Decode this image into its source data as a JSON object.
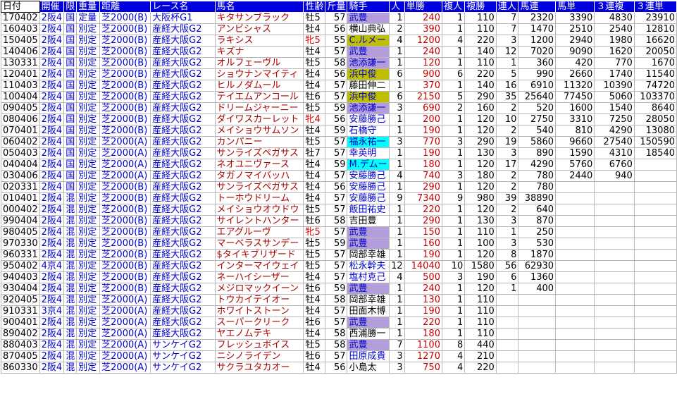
{
  "columns": [
    "日付",
    "開催",
    "限",
    "重量",
    "距離",
    "レース名",
    "馬名",
    "性齢",
    "斤量",
    "騎手",
    "人",
    "単勝",
    "複人",
    "複勝",
    "連人",
    "馬連",
    "馬単",
    "３連複",
    "３連単"
  ],
  "rows": [
    {
      "date": "170402",
      "kai": "2阪4",
      "gen": "国",
      "jyu": "定量",
      "kyori": "芝2000(B)",
      "race": "大阪杯G1",
      "horse": "キタサンブラック",
      "sei": "牡5",
      "kin": "57",
      "jockey": "武豊",
      "jk": "purple",
      "ninki": "1",
      "tansho": "240",
      "fukuninki": "1",
      "fukusho": "110",
      "renjin": "7",
      "umaren": "2320",
      "umatan": "3390",
      "sanfuku": "4830",
      "santan": "23910"
    },
    {
      "date": "160403",
      "kai": "2阪4",
      "gen": "国",
      "jyu": "別定",
      "kyori": "芝2000(B)",
      "race": "産経大阪G2",
      "horse": "アンビシャス",
      "sei": "牡4",
      "kin": "56",
      "jockey": "横山典弘",
      "jk": "",
      "ninki": "2",
      "tansho": "390",
      "fukuninki": "1",
      "fukusho": "110",
      "renjin": "7",
      "umaren": "1470",
      "umatan": "2510",
      "sanfuku": "2540",
      "santan": "12810"
    },
    {
      "date": "150405",
      "kai": "2阪4",
      "gen": "国",
      "jyu": "別定",
      "kyori": "芝2000(B)",
      "race": "産経大阪G2",
      "horse": "ラキシス",
      "sei": "牝5",
      "kin": "55",
      "jockey": "C.ルメー",
      "jk": "olive",
      "ninki": "4",
      "tansho": "1200",
      "fukuninki": "4",
      "fukusho": "220",
      "renjin": "3",
      "umaren": "1200",
      "umatan": "2940",
      "sanfuku": "1980",
      "santan": "16620"
    },
    {
      "date": "140406",
      "kai": "2阪4",
      "gen": "国",
      "jyu": "別定",
      "kyori": "芝2000(B)",
      "race": "産経大阪G2",
      "horse": "キズナ",
      "sei": "牡4",
      "kin": "57",
      "jockey": "武豊",
      "jk": "purple",
      "ninki": "1",
      "tansho": "240",
      "fukuninki": "1",
      "fukusho": "140",
      "renjin": "12",
      "umaren": "7020",
      "umatan": "9090",
      "sanfuku": "1620",
      "santan": "20050"
    },
    {
      "date": "130331",
      "kai": "2阪4",
      "gen": "国",
      "jyu": "別定",
      "kyori": "芝2000(B)",
      "race": "産経大阪G2",
      "horse": "オルフェーヴル",
      "sei": "牡5",
      "kin": "58",
      "jockey": "池添謙一",
      "jk": "purple",
      "ninki": "1",
      "tansho": "120",
      "fukuninki": "1",
      "fukusho": "110",
      "renjin": "1",
      "umaren": "360",
      "umatan": "420",
      "sanfuku": "770",
      "santan": "1670"
    },
    {
      "date": "120401",
      "kai": "2阪4",
      "gen": "国",
      "jyu": "別定",
      "kyori": "芝2000(B)",
      "race": "産経大阪G2",
      "horse": "ショウナンマイティ",
      "sei": "牡4",
      "kin": "56",
      "jockey": "浜中俊",
      "jk": "olive",
      "ninki": "6",
      "tansho": "900",
      "fukuninki": "6",
      "fukusho": "220",
      "renjin": "5",
      "umaren": "990",
      "umatan": "2660",
      "sanfuku": "1740",
      "santan": "11540"
    },
    {
      "date": "110403",
      "kai": "2阪4",
      "gen": "国",
      "jyu": "別定",
      "kyori": "芝2000(B)",
      "race": "産経大阪G2",
      "horse": "ヒルノダムール",
      "sei": "牡4",
      "kin": "57",
      "jockey": "藤田伸二",
      "jk": "",
      "ninki": "1",
      "tansho": "370",
      "fukuninki": "1",
      "fukusho": "140",
      "renjin": "16",
      "umaren": "6910",
      "umatan": "11320",
      "sanfuku": "10390",
      "santan": "74720"
    },
    {
      "date": "100404",
      "kai": "2阪4",
      "gen": "国",
      "jyu": "別定",
      "kyori": "芝2000(B)",
      "race": "産経大阪G2",
      "horse": "テイエムアンコール",
      "sei": "牡6",
      "kin": "57",
      "jockey": "浜中俊",
      "jk": "olive",
      "ninki": "6",
      "tansho": "2150",
      "fukuninki": "5",
      "fukusho": "290",
      "renjin": "35",
      "umaren": "25640",
      "umatan": "77450",
      "sanfuku": "5060",
      "santan": "103370"
    },
    {
      "date": "090405",
      "kai": "2阪4",
      "gen": "国",
      "jyu": "別定",
      "kyori": "芝2000(B)",
      "race": "産経大阪G2",
      "horse": "ドリームジャーニー",
      "sei": "牡5",
      "kin": "59",
      "jockey": "池添謙一",
      "jk": "purple",
      "ninki": "3",
      "tansho": "690",
      "fukuninki": "2",
      "fukusho": "160",
      "renjin": "2",
      "umaren": "520",
      "umatan": "1600",
      "sanfuku": "1540",
      "santan": "8640"
    },
    {
      "date": "080406",
      "kai": "2阪4",
      "gen": "国",
      "jyu": "別定",
      "kyori": "芝2000(B)",
      "race": "産経大阪G2",
      "horse": "ダイワスカーレット",
      "sei": "牝4",
      "kin": "56",
      "jockey": "安藤勝己",
      "jk": "blue",
      "ninki": "1",
      "tansho": "200",
      "fukuninki": "1",
      "fukusho": "120",
      "renjin": "10",
      "umaren": "2750",
      "umatan": "3310",
      "sanfuku": "7250",
      "santan": "28050"
    },
    {
      "date": "070401",
      "kai": "2阪4",
      "gen": "国",
      "jyu": "別定",
      "kyori": "芝2000(B)",
      "race": "産経大阪G2",
      "horse": "メイショウサムソン",
      "sei": "牡4",
      "kin": "59",
      "jockey": "石橋守",
      "jk": "blue",
      "ninki": "1",
      "tansho": "190",
      "fukuninki": "1",
      "fukusho": "120",
      "renjin": "2",
      "umaren": "540",
      "umatan": "810",
      "sanfuku": "4290",
      "santan": "13080"
    },
    {
      "date": "060402",
      "kai": "2阪4",
      "gen": "国",
      "jyu": "別定",
      "kyori": "芝2000(A)",
      "race": "産経大阪G2",
      "horse": "カンパニー",
      "sei": "牡5",
      "kin": "57",
      "jockey": "福永祐一",
      "jk": "cyan",
      "ninki": "3",
      "tansho": "770",
      "fukuninki": "3",
      "fukusho": "290",
      "renjin": "19",
      "umaren": "5860",
      "umatan": "9660",
      "sanfuku": "27540",
      "santan": "150590"
    },
    {
      "date": "050403",
      "kai": "2阪4",
      "gen": "国",
      "jyu": "別定",
      "kyori": "芝2000(A)",
      "race": "産経大阪G2",
      "horse": "サンライズペガサス",
      "sei": "牡7",
      "kin": "57",
      "jockey": "幸英明",
      "jk": "blue",
      "ninki": "1",
      "tansho": "190",
      "fukuninki": "1",
      "fukusho": "130",
      "renjin": "3",
      "umaren": "890",
      "umatan": "1590",
      "sanfuku": "4310",
      "santan": "18540"
    },
    {
      "date": "040404",
      "kai": "2阪4",
      "gen": "国",
      "jyu": "別定",
      "kyori": "芝2000(A)",
      "race": "産経大阪G2",
      "horse": "ネオユニヴァース",
      "sei": "牡4",
      "kin": "59",
      "jockey": "M.デムー",
      "jk": "cyan",
      "ninki": "1",
      "tansho": "180",
      "fukuninki": "1",
      "fukusho": "120",
      "renjin": "17",
      "umaren": "4290",
      "umatan": "5760",
      "sanfuku": "6760",
      "santan": ""
    },
    {
      "date": "030406",
      "kai": "2阪4",
      "gen": "国",
      "jyu": "別定",
      "kyori": "芝2000(A)",
      "race": "産経大阪G2",
      "horse": "タガノマイバッハ",
      "sei": "牡4",
      "kin": "57",
      "jockey": "安藤勝己",
      "jk": "blue",
      "ninki": "4",
      "tansho": "740",
      "fukuninki": "3",
      "fukusho": "180",
      "renjin": "2",
      "umaren": "780",
      "umatan": "2440",
      "sanfuku": "940",
      "santan": ""
    },
    {
      "date": "020331",
      "kai": "2阪4",
      "gen": "国",
      "jyu": "別定",
      "kyori": "芝2000(B)",
      "race": "産経大阪G2",
      "horse": "サンライズペガサス",
      "sei": "牡4",
      "kin": "56",
      "jockey": "安藤勝己",
      "jk": "blue",
      "ninki": "1",
      "tansho": "290",
      "fukuninki": "1",
      "fukusho": "120",
      "renjin": "2",
      "umaren": "780",
      "umatan": "",
      "sanfuku": "",
      "santan": ""
    },
    {
      "date": "010401",
      "kai": "2阪4",
      "gen": "混",
      "jyu": "別定",
      "kyori": "芝2000(B)",
      "race": "産経大阪G2",
      "horse": "トーホウドリーム",
      "sei": "牡4",
      "kin": "57",
      "jockey": "安藤勝己",
      "jk": "blue",
      "ninki": "9",
      "tansho": "7340",
      "fukuninki": "9",
      "fukusho": "980",
      "renjin": "39",
      "umaren": "38890",
      "umatan": "",
      "sanfuku": "",
      "santan": ""
    },
    {
      "date": "000402",
      "kai": "2阪4",
      "gen": "混",
      "jyu": "別定",
      "kyori": "芝2000(B)",
      "race": "産経大阪G2",
      "horse": "メイショウオウドウ",
      "sei": "牡5",
      "kin": "57",
      "jockey": "飯田祐史",
      "jk": "blue",
      "ninki": "1",
      "tansho": "220",
      "fukuninki": "1",
      "fukusho": "120",
      "renjin": "2",
      "umaren": "640",
      "umatan": "",
      "sanfuku": "",
      "santan": ""
    },
    {
      "date": "990404",
      "kai": "2阪4",
      "gen": "混",
      "jyu": "別定",
      "kyori": "芝2000(B)",
      "race": "産経大阪G2",
      "horse": "サイレントハンター",
      "sei": "牡6",
      "kin": "58",
      "jockey": "吉田豊",
      "jk": "",
      "ninki": "1",
      "tansho": "290",
      "fukuninki": "1",
      "fukusho": "130",
      "renjin": "3",
      "umaren": "870",
      "umatan": "",
      "sanfuku": "",
      "santan": ""
    },
    {
      "date": "980405",
      "kai": "2阪4",
      "gen": "混",
      "jyu": "別定",
      "kyori": "芝2000(B)",
      "race": "産経大阪G2",
      "horse": "エアグルーヴ",
      "sei": "牝5",
      "kin": "57",
      "jockey": "武豊",
      "jk": "purple",
      "ninki": "1",
      "tansho": "150",
      "fukuninki": "1",
      "fukusho": "110",
      "renjin": "1",
      "umaren": "250",
      "umatan": "",
      "sanfuku": "",
      "santan": ""
    },
    {
      "date": "970330",
      "kai": "2阪4",
      "gen": "混",
      "jyu": "別定",
      "kyori": "芝2000(B)",
      "race": "産経大阪G2",
      "horse": "マーベラスサンデー",
      "sei": "牡5",
      "kin": "59",
      "jockey": "武豊",
      "jk": "purple",
      "ninki": "1",
      "tansho": "160",
      "fukuninki": "1",
      "fukusho": "100",
      "renjin": "3",
      "umaren": "530",
      "umatan": "",
      "sanfuku": "",
      "santan": ""
    },
    {
      "date": "960331",
      "kai": "2阪4",
      "gen": "混",
      "jyu": "別定",
      "kyori": "芝2000(B)",
      "race": "産経大阪G2",
      "horse": "$タイキブリザード",
      "sei": "牡5",
      "kin": "57",
      "jockey": "岡部幸雄",
      "jk": "",
      "ninki": "1",
      "tansho": "190",
      "fukuninki": "1",
      "fukusho": "120",
      "renjin": "8",
      "umaren": "1870",
      "umatan": "",
      "sanfuku": "",
      "santan": ""
    },
    {
      "date": "950402",
      "kai": "4京4",
      "gen": "混",
      "jyu": "別定",
      "kyori": "芝2000(B)",
      "race": "産経大阪G2",
      "horse": "インターマイウェイ",
      "sei": "牡5",
      "kin": "57",
      "jockey": "松永幹夫",
      "jk": "blue",
      "ninki": "12",
      "tansho": "14040",
      "fukuninki": "10",
      "fukusho": "1580",
      "renjin": "56",
      "umaren": "62930",
      "umatan": "",
      "sanfuku": "",
      "santan": ""
    },
    {
      "date": "940403",
      "kai": "2阪4",
      "gen": "混",
      "jyu": "別定",
      "kyori": "芝2000(B)",
      "race": "産経大阪G2",
      "horse": "ネーハイシーザー",
      "sei": "牡4",
      "kin": "57",
      "jockey": "塩村克己",
      "jk": "blue",
      "ninki": "4",
      "tansho": "500",
      "fukuninki": "3",
      "fukusho": "190",
      "renjin": "6",
      "umaren": "1360",
      "umatan": "",
      "sanfuku": "",
      "santan": ""
    },
    {
      "date": "930404",
      "kai": "2阪4",
      "gen": "混",
      "jyu": "別定",
      "kyori": "芝2000(B)",
      "race": "産経大阪G2",
      "horse": "メジロマックイーン",
      "sei": "牡6",
      "kin": "59",
      "jockey": "武豊",
      "jk": "purple",
      "ninki": "1",
      "tansho": "240",
      "fukuninki": "1",
      "fukusho": "120",
      "renjin": "1",
      "umaren": "400",
      "umatan": "",
      "sanfuku": "",
      "santan": ""
    },
    {
      "date": "920405",
      "kai": "2阪4",
      "gen": "混",
      "jyu": "別定",
      "kyori": "芝2000(A)",
      "race": "産経大阪G2",
      "horse": "トウカイテイオー",
      "sei": "牡4",
      "kin": "58",
      "jockey": "岡部幸雄",
      "jk": "",
      "ninki": "1",
      "tansho": "130",
      "fukuninki": "1",
      "fukusho": "110",
      "renjin": "",
      "umaren": "",
      "umatan": "",
      "sanfuku": "",
      "santan": ""
    },
    {
      "date": "910331",
      "kai": "3京4",
      "gen": "混",
      "jyu": "別定",
      "kyori": "芝2000(A)",
      "race": "産経大阪G2",
      "horse": "ホワイトストーン",
      "sei": "牡4",
      "kin": "57",
      "jockey": "田面木博",
      "jk": "",
      "ninki": "1",
      "tansho": "190",
      "fukuninki": "1",
      "fukusho": "110",
      "renjin": "",
      "umaren": "",
      "umatan": "",
      "sanfuku": "",
      "santan": ""
    },
    {
      "date": "900401",
      "kai": "2阪4",
      "gen": "混",
      "jyu": "別定",
      "kyori": "芝2000(A)",
      "race": "産経大阪G2",
      "horse": "スーパークリーク",
      "sei": "牡6",
      "kin": "57",
      "jockey": "武豊",
      "jk": "purple",
      "ninki": "1",
      "tansho": "220",
      "fukuninki": "1",
      "fukusho": "110",
      "renjin": "",
      "umaren": "",
      "umatan": "",
      "sanfuku": "",
      "santan": ""
    },
    {
      "date": "890402",
      "kai": "2阪4",
      "gen": "混",
      "jyu": "別定",
      "kyori": "芝2000(A)",
      "race": "産経大阪G2",
      "horse": "ヤエノムテキ",
      "sei": "牡4",
      "kin": "58",
      "jockey": "西浦勝一",
      "jk": "",
      "ninki": "1",
      "tansho": "180",
      "fukuninki": "1",
      "fukusho": "110",
      "renjin": "",
      "umaren": "",
      "umatan": "",
      "sanfuku": "",
      "santan": ""
    },
    {
      "date": "880403",
      "kai": "2阪4",
      "gen": "混",
      "jyu": "別定",
      "kyori": "芝2000(A)",
      "race": "サンケイG2",
      "horse": "フレッシュボイス",
      "sei": "牡5",
      "kin": "58",
      "jockey": "武豊",
      "jk": "purple",
      "ninki": "7",
      "tansho": "1100",
      "fukuninki": "8",
      "fukusho": "440",
      "renjin": "",
      "umaren": "",
      "umatan": "",
      "sanfuku": "",
      "santan": ""
    },
    {
      "date": "870405",
      "kai": "2阪4",
      "gen": "混",
      "jyu": "別定",
      "kyori": "芝2000(A)",
      "race": "サンケイG2",
      "horse": "ニシノライデン",
      "sei": "牡6",
      "kin": "57",
      "jockey": "田原成貴",
      "jk": "blue",
      "ninki": "3",
      "tansho": "1270",
      "fukuninki": "4",
      "fukusho": "210",
      "renjin": "",
      "umaren": "",
      "umatan": "",
      "sanfuku": "",
      "santan": ""
    },
    {
      "date": "860330",
      "kai": "2阪4",
      "gen": "混",
      "jyu": "別定",
      "kyori": "芝2000(A)",
      "race": "サンケイG2",
      "horse": "サクラユタカオー",
      "sei": "牡4",
      "kin": "56",
      "jockey": "小島太",
      "jk": "",
      "ninki": "3",
      "tansho": "750",
      "fukuninki": "4",
      "fukusho": "220",
      "renjin": "",
      "umaren": "",
      "umatan": "",
      "sanfuku": "",
      "santan": ""
    }
  ]
}
